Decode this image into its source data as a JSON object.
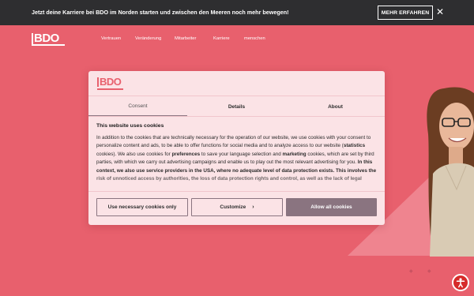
{
  "topbar": {
    "text": "Jetzt deine Karriere bei BDO im Norden starten und zwischen den Meeren noch mehr bewegen!",
    "button_label": "MEHR ERFAHREN",
    "close_icon": "close-icon"
  },
  "header": {
    "logo_text": "BDO",
    "nav": [
      "Vertrauen",
      "Veränderung",
      "Mitarbeiter",
      "Karriere",
      "menschen"
    ]
  },
  "dialog": {
    "logo_text": "BDO",
    "tabs": [
      "Consent",
      "Details",
      "About"
    ],
    "title": "This website uses cookies",
    "body": [
      {
        "t": "In addition to the cookies that are technically necessary for the operation of our website, we use cookies with your consent to personalize content and ads, to be able to offer functions for social media and to analyze access to our website (",
        "b": false
      },
      {
        "t": "statistics",
        "b": true
      },
      {
        "t": " cookies). We also use cookies for ",
        "b": false
      },
      {
        "t": "preferences",
        "b": true
      },
      {
        "t": " to save your language selection and ",
        "b": false
      },
      {
        "t": "marketing",
        "b": true
      },
      {
        "t": " cookies, which are set by third parties, with which we carry out advertising campaigns and enable us to play out the most relevant advertising for you. ",
        "b": false
      },
      {
        "t": "In this context, we also use service providers in the USA, where no adequate level of data protection exists. This involves the risk of unnoticed access by authorities, the loss of data protection rights and control, as well as the lack of legal remedies.",
        "b": true
      }
    ],
    "buttons": {
      "necessary": "Use necessary cookies only",
      "customize": "Customize",
      "allow": "Allow all cookies"
    }
  },
  "colors": {
    "background": "#e8606d",
    "topbar": "#2e2e30",
    "dialog": "#fbe3e6",
    "accent": "#8a7480"
  },
  "icons": {
    "accessibility": "accessibility-icon",
    "carousel": [
      "carousel-dot-icon",
      "carousel-dot-icon"
    ]
  }
}
